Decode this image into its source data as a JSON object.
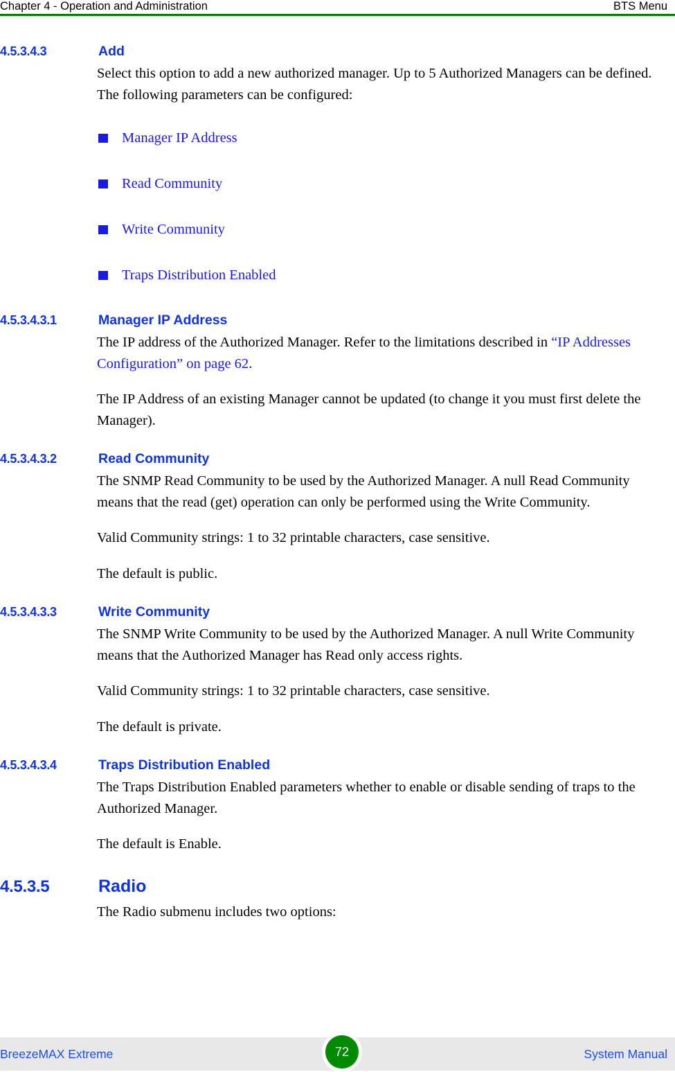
{
  "header": {
    "left": "Chapter 4 - Operation and Administration",
    "right": "BTS Menu",
    "rule_color": "#007d00"
  },
  "colors": {
    "heading_blue": "#0f33e0",
    "link_blue": "#1a1ae6",
    "footer_blue": "#1a4ef0",
    "rule_green": "#007d00",
    "badge_green": "#008a00",
    "footer_band": "#e8e8e8"
  },
  "sections": [
    {
      "number": "4.5.3.4.3",
      "title": "Add",
      "paragraphs": [
        "Select this option to add a new authorized manager. Up to 5 Authorized Managers can be defined. The following parameters can be configured:"
      ],
      "bullets": [
        "Manager IP Address",
        "Read Community",
        "Write Community",
        "Traps Distribution Enabled"
      ]
    },
    {
      "number": "4.5.3.4.3.1",
      "title": "Manager IP Address",
      "para_1_pre": "The IP address of the Authorized Manager. Refer to the limitations described in ",
      "para_1_link": "“IP Addresses Configuration” on page 62",
      "para_1_post": ".",
      "para_2": "The IP Address of an existing Manager cannot be updated (to change it you must first delete the Manager)."
    },
    {
      "number": "4.5.3.4.3.2",
      "title": "Read Community",
      "para_1": "The SNMP Read Community to be used by the Authorized Manager. A null Read Community means that the read (get) operation can only be performed using the Write Community.",
      "para_2": "Valid Community strings: 1 to 32 printable characters, case sensitive.",
      "para_3": "The default is public."
    },
    {
      "number": "4.5.3.4.3.3",
      "title": "Write Community",
      "para_1": "The SNMP Write Community to be used by the Authorized Manager. A null Write Community means that the Authorized Manager has Read only access rights.",
      "para_2": "Valid Community strings: 1 to 32 printable characters, case sensitive.",
      "para_3": "The default is private."
    },
    {
      "number": "4.5.3.4.3.4",
      "title": "Traps Distribution Enabled",
      "para_1": "The Traps Distribution Enabled parameters whether to enable or disable sending of traps to the Authorized Manager.",
      "para_2": "The default is Enable."
    },
    {
      "number": "4.5.3.5",
      "title": "Radio",
      "para_1": "The Radio submenu includes two options:"
    }
  ],
  "footer": {
    "left": "BreezeMAX Extreme",
    "page_number": "72",
    "right": "System Manual"
  }
}
